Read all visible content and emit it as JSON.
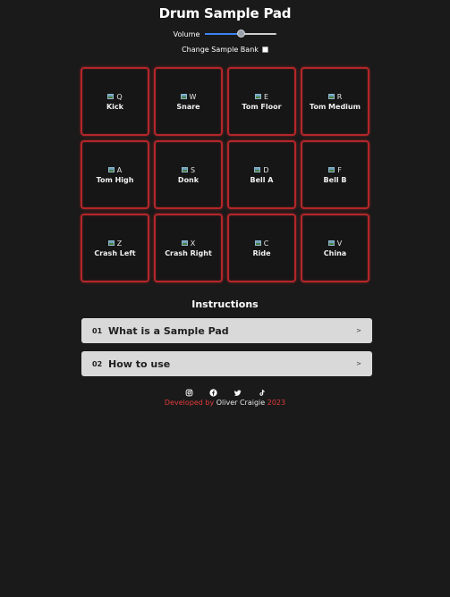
{
  "app": {
    "title": "Drum Sample Pad"
  },
  "controls": {
    "volume_label": "Volume",
    "volume_value": 0.5,
    "bank_label": "Change Sample Bank",
    "bank_checked": false
  },
  "pads": [
    {
      "key": "Q",
      "label": "Kick"
    },
    {
      "key": "W",
      "label": "Snare"
    },
    {
      "key": "E",
      "label": "Tom Floor"
    },
    {
      "key": "R",
      "label": "Tom Medium"
    },
    {
      "key": "A",
      "label": "Tom High"
    },
    {
      "key": "S",
      "label": "Donk"
    },
    {
      "key": "D",
      "label": "Bell A"
    },
    {
      "key": "F",
      "label": "Bell B"
    },
    {
      "key": "Z",
      "label": "Crash Left"
    },
    {
      "key": "X",
      "label": "Crash Right"
    },
    {
      "key": "C",
      "label": "Ride"
    },
    {
      "key": "V",
      "label": "China"
    }
  ],
  "instructions": {
    "title": "Instructions",
    "items": [
      {
        "num": "01",
        "label": "What is a Sample Pad",
        "arrow": ">"
      },
      {
        "num": "02",
        "label": "How to use",
        "arrow": ">"
      }
    ]
  },
  "socials": [
    {
      "icon": "instagram-icon"
    },
    {
      "icon": "facebook-icon"
    },
    {
      "icon": "twitter-icon"
    },
    {
      "icon": "tiktok-icon"
    }
  ],
  "footer": {
    "prefix": "Developed by",
    "name": "Oliver Craigie",
    "year": "2023"
  },
  "colors": {
    "background": "#1a1a1a",
    "pad_border": "#b3262a",
    "accent_red": "#e23b3b",
    "slider_blue": "#3b82f6"
  }
}
